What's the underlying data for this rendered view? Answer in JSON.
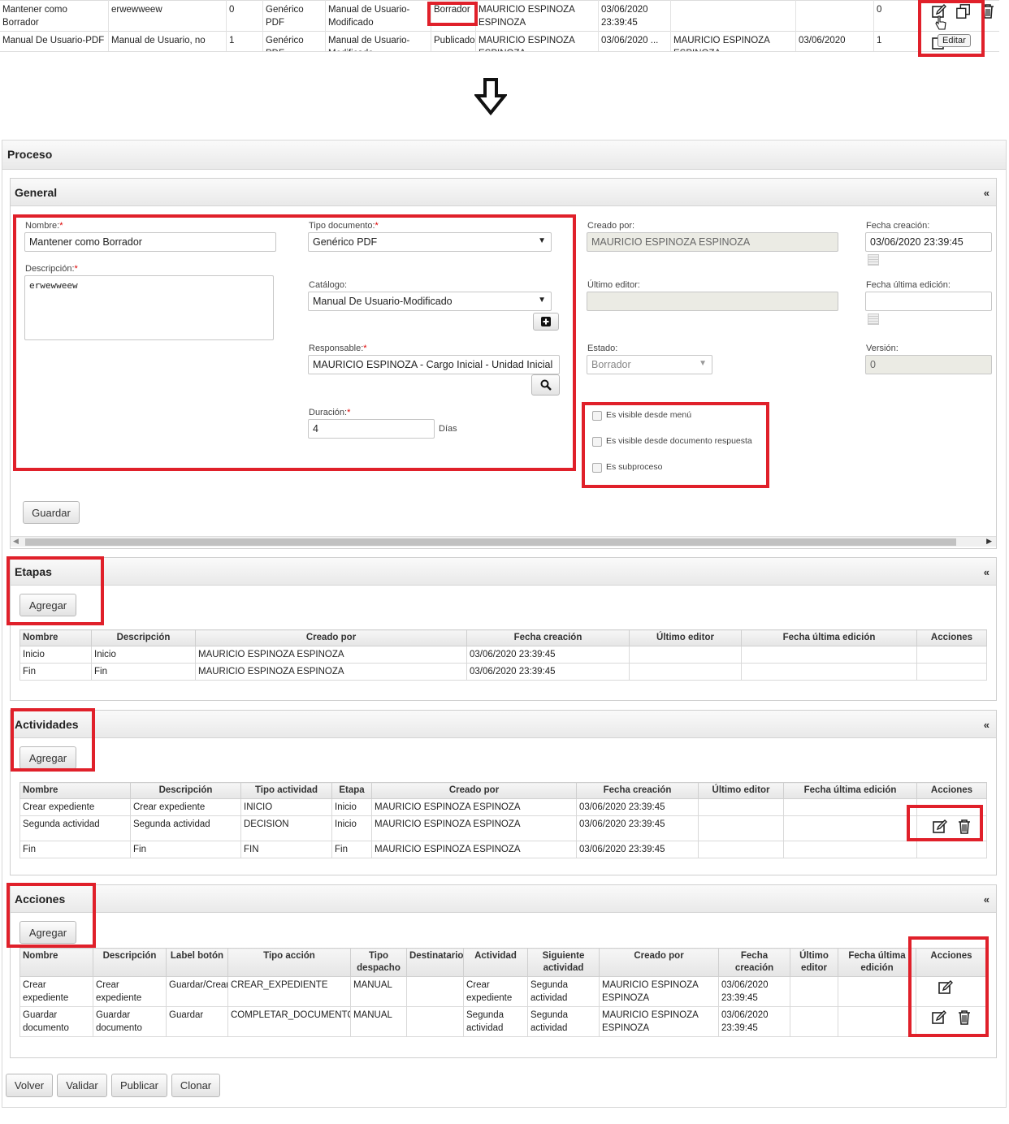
{
  "top_table": {
    "rows": [
      {
        "nombre": "Mantener como Borrador",
        "descripcion": "erwewweew",
        "version": "0",
        "tipo": "Genérico PDF",
        "catalogo": "Manual de Usuario-Modificado",
        "estado": "Borrador",
        "creado_por": "MAURICIO ESPINOZA ESPINOZA",
        "fecha_creacion": "03/06/2020 23:39:45",
        "editor": "",
        "fecha_edicion": "",
        "num": "0"
      },
      {
        "nombre": "Manual De Usuario-PDF",
        "descripcion": "Manual de Usuario, no",
        "version": "1",
        "tipo": "Genérico PDF",
        "catalogo": "Manual de Usuario-Modificado",
        "estado": "Publicado",
        "creado_por": "MAURICIO ESPINOZA ESPINOZA",
        "fecha_creacion": "03/06/2020 ...",
        "editor": "MAURICIO ESPINOZA ESPINOZA",
        "fecha_edicion": "03/06/2020",
        "num": "1"
      }
    ],
    "tooltip": "Editar"
  },
  "proceso": {
    "title": "Proceso",
    "general": {
      "title": "General",
      "collapse": "«",
      "nombre_label": "Nombre:",
      "nombre_value": "Mantener como Borrador",
      "descripcion_label": "Descripción:",
      "descripcion_value": "erwewweew",
      "tipo_label": "Tipo documento:",
      "tipo_value": "Genérico PDF",
      "catalogo_label": "Catálogo:",
      "catalogo_value": "Manual De Usuario-Modificado",
      "responsable_label": "Responsable:",
      "responsable_value": "MAURICIO ESPINOZA - Cargo Inicial - Unidad Inicial",
      "duracion_label": "Duración:",
      "duracion_value": "4",
      "duracion_unit": "Días",
      "creado_label": "Creado por:",
      "creado_value": "MAURICIO ESPINOZA ESPINOZA",
      "editor_label": "Último editor:",
      "editor_value": "",
      "estado_label": "Estado:",
      "estado_value": "Borrador",
      "fecha_creacion_label": "Fecha creación:",
      "fecha_creacion_value": "03/06/2020 23:39:45",
      "fecha_edicion_label": "Fecha última edición:",
      "fecha_edicion_value": "",
      "version_label": "Versión:",
      "version_value": "0",
      "chk1": "Es visible desde menú",
      "chk2": "Es visible desde documento respuesta",
      "chk3": "Es subproceso",
      "guardar": "Guardar",
      "required": "*"
    },
    "etapas": {
      "title": "Etapas",
      "collapse": "«",
      "agregar": "Agregar",
      "headers": [
        "Nombre",
        "Descripción",
        "Creado por",
        "Fecha creación",
        "Último editor",
        "Fecha última edición",
        "Acciones"
      ],
      "rows": [
        [
          "Inicio",
          "Inicio",
          "MAURICIO ESPINOZA ESPINOZA",
          "03/06/2020 23:39:45",
          "",
          "",
          ""
        ],
        [
          "Fin",
          "Fin",
          "MAURICIO ESPINOZA ESPINOZA",
          "03/06/2020 23:39:45",
          "",
          "",
          ""
        ]
      ]
    },
    "actividades": {
      "title": "Actividades",
      "collapse": "«",
      "agregar": "Agregar",
      "headers": [
        "Nombre",
        "Descripción",
        "Tipo actividad",
        "Etapa",
        "Creado por",
        "Fecha creación",
        "Último editor",
        "Fecha última edición",
        "Acciones"
      ],
      "rows": [
        [
          "Crear expediente",
          "Crear expediente",
          "INICIO",
          "Inicio",
          "MAURICIO ESPINOZA ESPINOZA",
          "03/06/2020 23:39:45",
          "",
          ""
        ],
        [
          "Segunda actividad",
          "Segunda actividad",
          "DECISION",
          "Inicio",
          "MAURICIO ESPINOZA ESPINOZA",
          "03/06/2020 23:39:45",
          "",
          ""
        ],
        [
          "Fin",
          "Fin",
          "FIN",
          "Fin",
          "MAURICIO ESPINOZA ESPINOZA",
          "03/06/2020 23:39:45",
          "",
          ""
        ]
      ]
    },
    "acciones": {
      "title": "Acciones",
      "collapse": "«",
      "agregar": "Agregar",
      "headers": [
        "Nombre",
        "Descripción",
        "Label botón",
        "Tipo acción",
        "Tipo despacho",
        "Destinatario",
        "Actividad",
        "Siguiente actividad",
        "Creado por",
        "Fecha creación",
        "Último editor",
        "Fecha última edición",
        "Acciones"
      ],
      "rows": [
        [
          "Crear expediente",
          "Crear expediente",
          "Guardar/Crear",
          "CREAR_EXPEDIENTE",
          "MANUAL",
          "",
          "Crear expediente",
          "Segunda actividad",
          "MAURICIO ESPINOZA ESPINOZA",
          "03/06/2020 23:39:45",
          "",
          ""
        ],
        [
          "Guardar documento",
          "Guardar documento",
          "Guardar",
          "COMPLETAR_DOCUMENTO",
          "MANUAL",
          "",
          "Segunda actividad",
          "Segunda actividad",
          "MAURICIO ESPINOZA ESPINOZA",
          "03/06/2020 23:39:45",
          "",
          ""
        ]
      ]
    },
    "footer": {
      "volver": "Volver",
      "validar": "Validar",
      "publicar": "Publicar",
      "clonar": "Clonar"
    }
  },
  "colors": {
    "highlight": "#e0202a"
  }
}
